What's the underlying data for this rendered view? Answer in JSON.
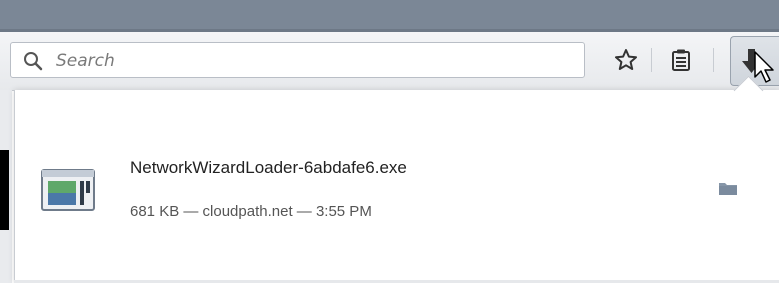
{
  "toolbar": {
    "search": {
      "placeholder": "Search"
    },
    "bookmark_icon": "star-icon",
    "reading_list_icon": "clipboard-icon",
    "downloads_icon": "download-arrow-icon"
  },
  "downloads_panel": {
    "items": [
      {
        "file_name": "NetworkWizardLoader-6abdafe6.exe",
        "status": "681 KB — cloudpath.net — 3:55 PM",
        "icon": "executable-file-icon",
        "action_icon": "folder-icon"
      }
    ]
  },
  "colors": {
    "titlebar": "#7b8796",
    "toolbar": "#eceef1",
    "panel": "#ffffff",
    "folder_icon": "#8696a8"
  }
}
